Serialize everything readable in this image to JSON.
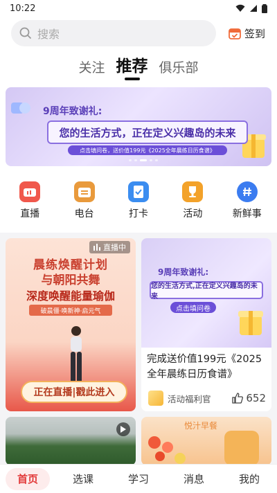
{
  "status": {
    "time": "10:22"
  },
  "search": {
    "placeholder": "搜索"
  },
  "checkin": {
    "label": "签到"
  },
  "tabs": [
    {
      "label": "关注",
      "active": false
    },
    {
      "label": "推荐",
      "active": true
    },
    {
      "label": "俱乐部",
      "active": false
    }
  ],
  "banner": {
    "line1": "9周年致谢礼:",
    "line2": "您的生活方式，正在定义兴趣岛的未来",
    "line3": "点击填问卷，送价值199元《2025全年晨练日历食谱》"
  },
  "quick_links": [
    {
      "label": "直播",
      "icon": "live-tv-icon",
      "color": "#f0584c"
    },
    {
      "label": "电台",
      "icon": "radio-icon",
      "color": "#e99a3c"
    },
    {
      "label": "打卡",
      "icon": "book-check-icon",
      "color": "#3b8df0"
    },
    {
      "label": "活动",
      "icon": "trophy-icon",
      "color": "#f3a22a"
    },
    {
      "label": "新鲜事",
      "icon": "hashtag-bubble-icon",
      "color": "#3b7cf0"
    }
  ],
  "live_card": {
    "badge": "直播中",
    "title1": "晨练焕醒计划",
    "title2": "与朝阳共舞",
    "title3": "深度唤醒能量瑜伽",
    "sub": "破晨僵·唤新神·启元气",
    "button": "正在直播|戳此进入"
  },
  "post_card": {
    "img_line1": "9周年致谢礼:",
    "img_line2": "您的生活方式,正在定义兴趣岛的未来",
    "img_button": "点击填问卷",
    "title": "完成送价值199元《2025全年晨练日历食谱》",
    "author": "活动福利官",
    "likes": "652"
  },
  "food_card": {
    "title": "悦汁早餐"
  },
  "bottom_nav": [
    {
      "label": "首页",
      "active": true
    },
    {
      "label": "选课",
      "active": false
    },
    {
      "label": "学习",
      "active": false
    },
    {
      "label": "消息",
      "active": false
    },
    {
      "label": "我的",
      "active": false
    }
  ],
  "colors": {
    "accent": "#e23b3b",
    "banner_purple": "#6b4fd8"
  }
}
